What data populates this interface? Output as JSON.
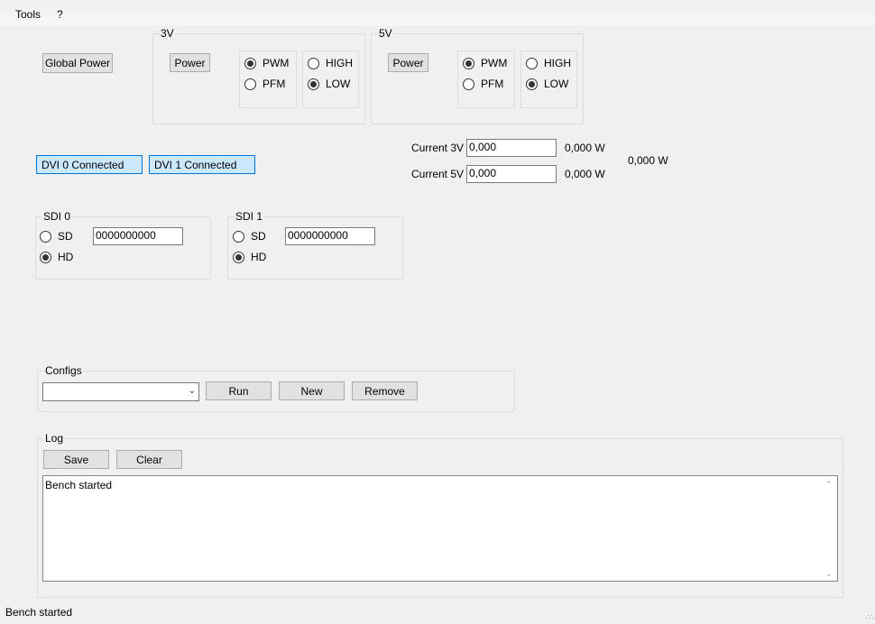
{
  "menu": {
    "tools": "Tools",
    "help": "?"
  },
  "global_power": {
    "label": "Global Power"
  },
  "rail_3v": {
    "title": "3V",
    "power_label": "Power",
    "mode": [
      {
        "label": "PWM",
        "checked": true
      },
      {
        "label": "PFM",
        "checked": false
      }
    ],
    "level": [
      {
        "label": "HIGH",
        "checked": false
      },
      {
        "label": "LOW",
        "checked": true
      }
    ]
  },
  "rail_5v": {
    "title": "5V",
    "power_label": "Power",
    "mode": [
      {
        "label": "PWM",
        "checked": true
      },
      {
        "label": "PFM",
        "checked": false
      }
    ],
    "level": [
      {
        "label": "HIGH",
        "checked": false
      },
      {
        "label": "LOW",
        "checked": true
      }
    ]
  },
  "dvi": {
    "dvi0": "DVI 0 Connected",
    "dvi1": "DVI 1 Connected",
    "color": "#cce8ff",
    "border": "#0078d7"
  },
  "current": {
    "c3v_label": "Current 3V",
    "c3v_value": "0,000",
    "c3v_power": "0,000 W",
    "c5v_label": "Current 5V",
    "c5v_value": "0,000",
    "c5v_power": "0,000 W",
    "total_power": "0,000 W"
  },
  "sdi0": {
    "title": "SDI 0",
    "sd_label": "SD",
    "hd_label": "HD",
    "selected": "HD",
    "value": "0000000000"
  },
  "sdi1": {
    "title": "SDI 1",
    "sd_label": "SD",
    "hd_label": "HD",
    "selected": "HD",
    "value": "0000000000"
  },
  "configs": {
    "title": "Configs",
    "selected": "",
    "run": "Run",
    "new": "New",
    "remove": "Remove"
  },
  "log": {
    "title": "Log",
    "save": "Save",
    "clear": "Clear",
    "text": "Bench started"
  },
  "status": {
    "text": "Bench started"
  },
  "icons": {
    "dropdown": "chevron-down-icon",
    "scroll_up": "scroll-up-arrow-icon",
    "scroll_down": "scroll-down-arrow-icon",
    "resize": "resize-grip-icon"
  }
}
